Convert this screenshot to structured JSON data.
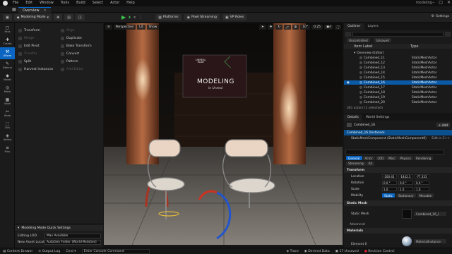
{
  "window": {
    "title": "modeling",
    "menu": [
      "File",
      "Edit",
      "Window",
      "Tools",
      "Build",
      "Select",
      "Actor",
      "Help"
    ],
    "tab": "Overview"
  },
  "toolbar": {
    "mode": "Modeling Mode",
    "platforms": "Platforms",
    "pixel_streaming": "Pixel Streaming",
    "vp_roles": "VP Roles",
    "settings": "Settings"
  },
  "strip": [
    {
      "glyph": "▢",
      "label": "Favs"
    },
    {
      "glyph": "✚",
      "label": "Create"
    },
    {
      "glyph": "⚒",
      "label": "XForm",
      "selected": true
    },
    {
      "glyph": "✎",
      "label": "Deform"
    },
    {
      "glyph": "◆",
      "label": "Model"
    },
    {
      "glyph": "◎",
      "label": "Mesh"
    },
    {
      "glyph": "▦",
      "label": "Voxel"
    },
    {
      "glyph": "✂",
      "label": "Bake"
    },
    {
      "glyph": "⬚",
      "label": "UVs"
    },
    {
      "glyph": "◈",
      "label": "Attribs"
    },
    {
      "glyph": "≡",
      "label": "Misc"
    }
  ],
  "tools": {
    "left": [
      {
        "label": "Transform",
        "enabled": true
      },
      {
        "label": "Merge",
        "enabled": false
      },
      {
        "label": "Edit Pivot",
        "enabled": true
      },
      {
        "label": "Transfer",
        "enabled": false
      },
      {
        "label": "Split",
        "enabled": true
      },
      {
        "label": "Harvest Instances",
        "enabled": true
      }
    ],
    "right": [
      {
        "label": "Align",
        "enabled": false
      },
      {
        "label": "Duplicate",
        "enabled": true
      },
      {
        "label": "Bake Transform",
        "enabled": true
      },
      {
        "label": "Convert",
        "enabled": true
      },
      {
        "label": "Pattern",
        "enabled": true
      },
      {
        "label": "Add Editor",
        "enabled": false
      }
    ]
  },
  "quick_settings": {
    "title": "Modeling Mode Quick Settings",
    "editing_lod_label": "Editing LOD",
    "editing_lod_value": "Max Available",
    "new_asset_label": "New Asset Location",
    "new_asset_value": "AutoGen Folder (World-Relative)"
  },
  "viewport": {
    "perspective": "Perspective",
    "lit": "Lit",
    "show": "Show",
    "snap_angle": "10°",
    "snap_scale": "0.25",
    "camera": "4",
    "screen_logo": "UNREAL",
    "screen_logo_sub": "ENGINE",
    "screen_title": "MODELING",
    "screen_subtitle": "in Unreal"
  },
  "outliner": {
    "tabs": [
      "Outliner",
      "Layers"
    ],
    "filters": [
      "Uncontrolled",
      "Unsaved"
    ],
    "col_label": "Item Label",
    "col_type": "Type",
    "root": "Overview (Editor)",
    "items": [
      {
        "label": "Combined_11",
        "type": "StaticMeshActor"
      },
      {
        "label": "Combined_12",
        "type": "StaticMeshActor"
      },
      {
        "label": "Combined_13",
        "type": "StaticMeshActor"
      },
      {
        "label": "Combined_14",
        "type": "StaticMeshActor"
      },
      {
        "label": "Combined_15",
        "type": "StaticMeshActor"
      },
      {
        "label": "Combined_16",
        "type": "StaticMeshActor",
        "selected": true
      },
      {
        "label": "Combined_17",
        "type": "StaticMeshActor"
      },
      {
        "label": "Combined_18",
        "type": "StaticMeshActor"
      },
      {
        "label": "Combined_19",
        "type": "StaticMeshActor"
      },
      {
        "label": "Combined_20",
        "type": "StaticMeshActor"
      }
    ],
    "count": "361 actors (1 selected)"
  },
  "details": {
    "tabs": [
      "Details",
      "World Settings"
    ],
    "actor": "Combined_16",
    "add": "+ Add",
    "instance": "Combined_16 (Instance)",
    "component": "StaticMeshComponent (StaticMeshComponent0)",
    "edit_cpp": "Edit in C++",
    "filter_tabs": [
      "General",
      "Actor",
      "LOD",
      "Misc",
      "Physics",
      "Rendering",
      "Streaming",
      "All"
    ],
    "transform_label": "Transform",
    "location_label": "Location",
    "location": [
      "-200.43",
      "-1442.3",
      "-77.333"
    ],
    "rotation_label": "Rotation",
    "rotation": [
      "0.0 °",
      "0.0 °",
      "0.0 °"
    ],
    "scale_label": "Scale",
    "scale": [
      "1.0",
      "1.0",
      "1.0"
    ],
    "mobility_label": "Mobility",
    "mobility": [
      "Static",
      "Stationary",
      "Movable"
    ],
    "static_mesh_cat": "Static Mesh",
    "static_mesh_label": "Static Mesh",
    "static_mesh_value": "Combined_16_I",
    "advanced": "Advanced",
    "materials_cat": "Materials",
    "element_label": "Element 0",
    "material_value": "MaterialInstance"
  },
  "status": {
    "content_drawer": "Content Drawer",
    "output_log": "Output Log",
    "cmd": "Cmd",
    "cmd_placeholder": "Enter Console Command",
    "trace": "Trace",
    "derived_data": "Derived Data",
    "unsaved": "17 Unsaved",
    "revision": "Revision Control"
  },
  "colors": {
    "accent": "#0a66c2",
    "bg": "#151515"
  }
}
